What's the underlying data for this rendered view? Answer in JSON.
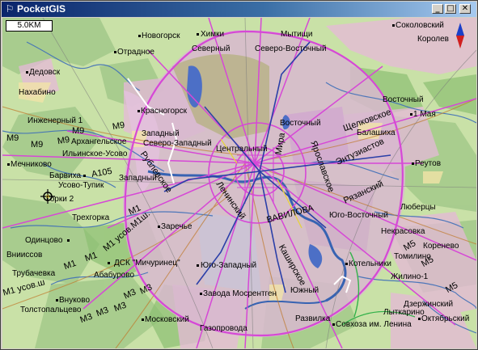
{
  "window": {
    "title": "PocketGIS",
    "icon": "compass-logo-icon",
    "buttons": [
      "minimize",
      "maximize",
      "close"
    ]
  },
  "map": {
    "scale": "5.0KM",
    "controls": {
      "compass": "north-arrow-icon",
      "position_marker": "gps-crosshair-icon"
    },
    "labels": {
      "novogorsk": "Новогорск",
      "khimki": "Химки",
      "mytishchi": "Мытищи",
      "sokolovsky": "Соколовский",
      "korolev": "Королев",
      "otradnoe": "Отрадное",
      "severny": "Северный",
      "severo_vostochny": "Северо-Восточный",
      "dedovsk": "Дедовск",
      "nakhabino": "Нахабино",
      "vostochny_top": "Восточный",
      "may1": "1 Мая",
      "inzhenerny1": "Инженерный 1",
      "krasnogorsk": "Красногорск",
      "vostochny": "Восточный",
      "shchelkovskoe": "Щелковское",
      "balashikha": "Балашиха",
      "m9_a": "M9",
      "m9_b": "M9",
      "m9_c": "M9",
      "m9_d": "M9",
      "m9_e": "M9",
      "zapadny": "Западный",
      "arkhangelskoe": "Архангельское",
      "severo_zapadny": "Северо-Западный",
      "tsentralny": "Центральный",
      "mira": "Мира",
      "yaroslavskoe": "Ярославское",
      "entuziastov": "Энтузиастов",
      "ilinskoe_usovo": "Ильинское-Усово",
      "reutov": "Реутов",
      "rublevskoe": "Рублевское",
      "mechnikovo": "Мечниково",
      "barvikha": "Барвиха",
      "a105": "А105",
      "zapadny2": "Западный",
      "usovo_tupik": "Усово-Тупик",
      "leninsky": "Ленинский",
      "ryazansky": "Рязанский",
      "gorki2": "Горки 2",
      "lyubertsy": "Люберцы",
      "trekhgorka": "Трехгорка",
      "m1_a": "M1",
      "m1usov": "M1 усов.М1ш.",
      "yugo_vostochny": "Юго-Восточный",
      "zarechye": "Заречье",
      "vavilova": "ВАВИЛОВА",
      "nekrasovka": "Некрасовка",
      "odintsovo": "Одинцово",
      "m1_b": "M1",
      "m1_c": "M1",
      "m5_a": "M5",
      "kozhukhovo": "Кореневo",
      "vniissov": "Внииссов",
      "dsk_michurinets": "ДСК \"Мичуринец\"",
      "yugo_zapadny": "Юго-Западный",
      "kashirskoe": "Каширское",
      "kotelniki": "Котельники",
      "tomilino": "Томилино",
      "m5_b": "M5",
      "trubachevka": "Трубачевка",
      "ababurovo": "Абабурово",
      "m1usovsh": "M1 усов.ш",
      "m3_a": "M3",
      "m3_b": "M3",
      "zhilino1": "Жилино-1",
      "m5_c": "M5",
      "vnukovo": "Внуково",
      "zavoda_mosrentgen": "Завода Мосрентген",
      "yuzhny": "Южный",
      "dzerzhinsky": "Дзержинский",
      "tolstopaltsevo": "Толстопальцево",
      "m3_c": "M3",
      "m3_d": "M3",
      "m3_e": "M3",
      "lytkarino": "Лыткарино",
      "moskovsky": "Московский",
      "razvilka": "Развилка",
      "oktyabrsky": "Октябрьский",
      "gazoprovoda": "Газопровода",
      "sovkhoz_lenina": "Совхоза им. Ленина"
    }
  }
}
